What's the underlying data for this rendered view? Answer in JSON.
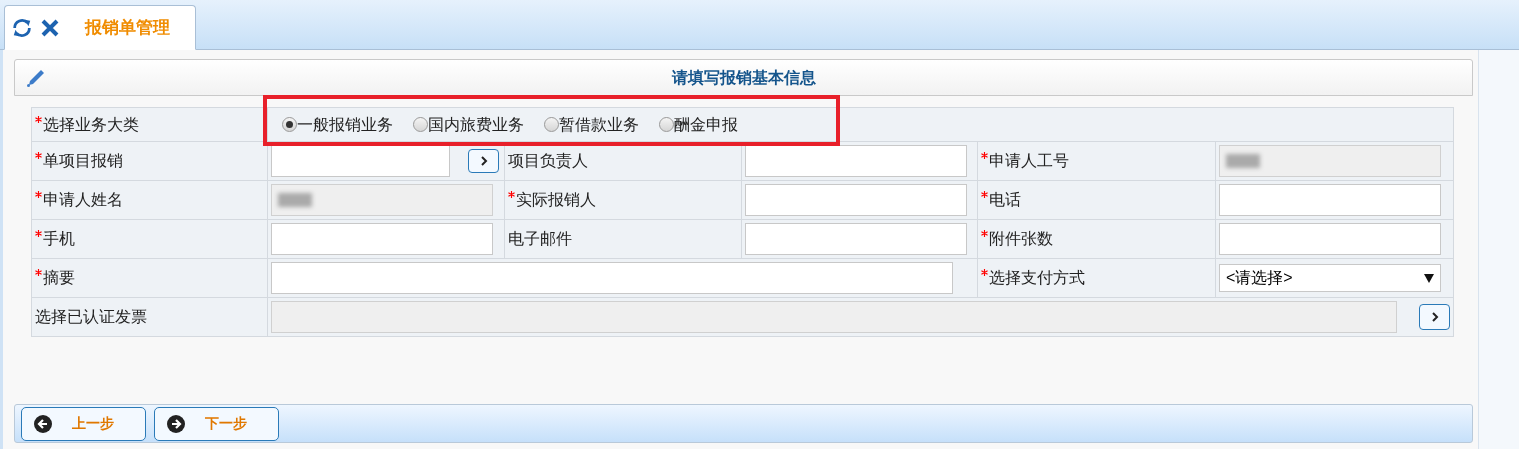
{
  "tab": {
    "title": "报销单管理",
    "selected": true
  },
  "panel": {
    "title": "请填写报销基本信息"
  },
  "category": {
    "label": "选择业务大类",
    "required": true,
    "options": [
      {
        "label": "一般报销业务",
        "selected": true
      },
      {
        "label": "国内旅费业务",
        "selected": false
      },
      {
        "label": "暂借款业务",
        "selected": false
      },
      {
        "label": "酬金申报",
        "selected": false
      }
    ]
  },
  "rows": [
    [
      {
        "kind": "label",
        "text": "单项目报销",
        "required": true
      },
      {
        "kind": "lookup"
      },
      {
        "kind": "label",
        "text": "项目负责人",
        "required": false
      },
      {
        "kind": "input"
      },
      {
        "kind": "label",
        "text": "申请人工号",
        "required": true
      },
      {
        "kind": "redacted"
      }
    ],
    [
      {
        "kind": "label",
        "text": "申请人姓名",
        "required": true
      },
      {
        "kind": "redacted"
      },
      {
        "kind": "label",
        "text": "实际报销人",
        "required": true
      },
      {
        "kind": "input"
      },
      {
        "kind": "label",
        "text": "电话",
        "required": true
      },
      {
        "kind": "input"
      }
    ],
    [
      {
        "kind": "label",
        "text": "手机",
        "required": true
      },
      {
        "kind": "input"
      },
      {
        "kind": "label",
        "text": "电子邮件",
        "required": false
      },
      {
        "kind": "input"
      },
      {
        "kind": "label",
        "text": "附件张数",
        "required": true
      },
      {
        "kind": "input"
      }
    ],
    [
      {
        "kind": "label",
        "text": "摘要",
        "required": true
      },
      {
        "kind": "wide_input"
      },
      {
        "kind": "label",
        "text": "选择支付方式",
        "required": true
      },
      {
        "kind": "select",
        "value": "<请选择>"
      }
    ],
    [
      {
        "kind": "label",
        "text": "选择已认证发票",
        "required": false
      },
      {
        "kind": "wide_lookup"
      }
    ]
  ],
  "buttons": [
    {
      "label": "上一步",
      "kind": "back"
    },
    {
      "label": "下一步",
      "kind": "next"
    }
  ]
}
